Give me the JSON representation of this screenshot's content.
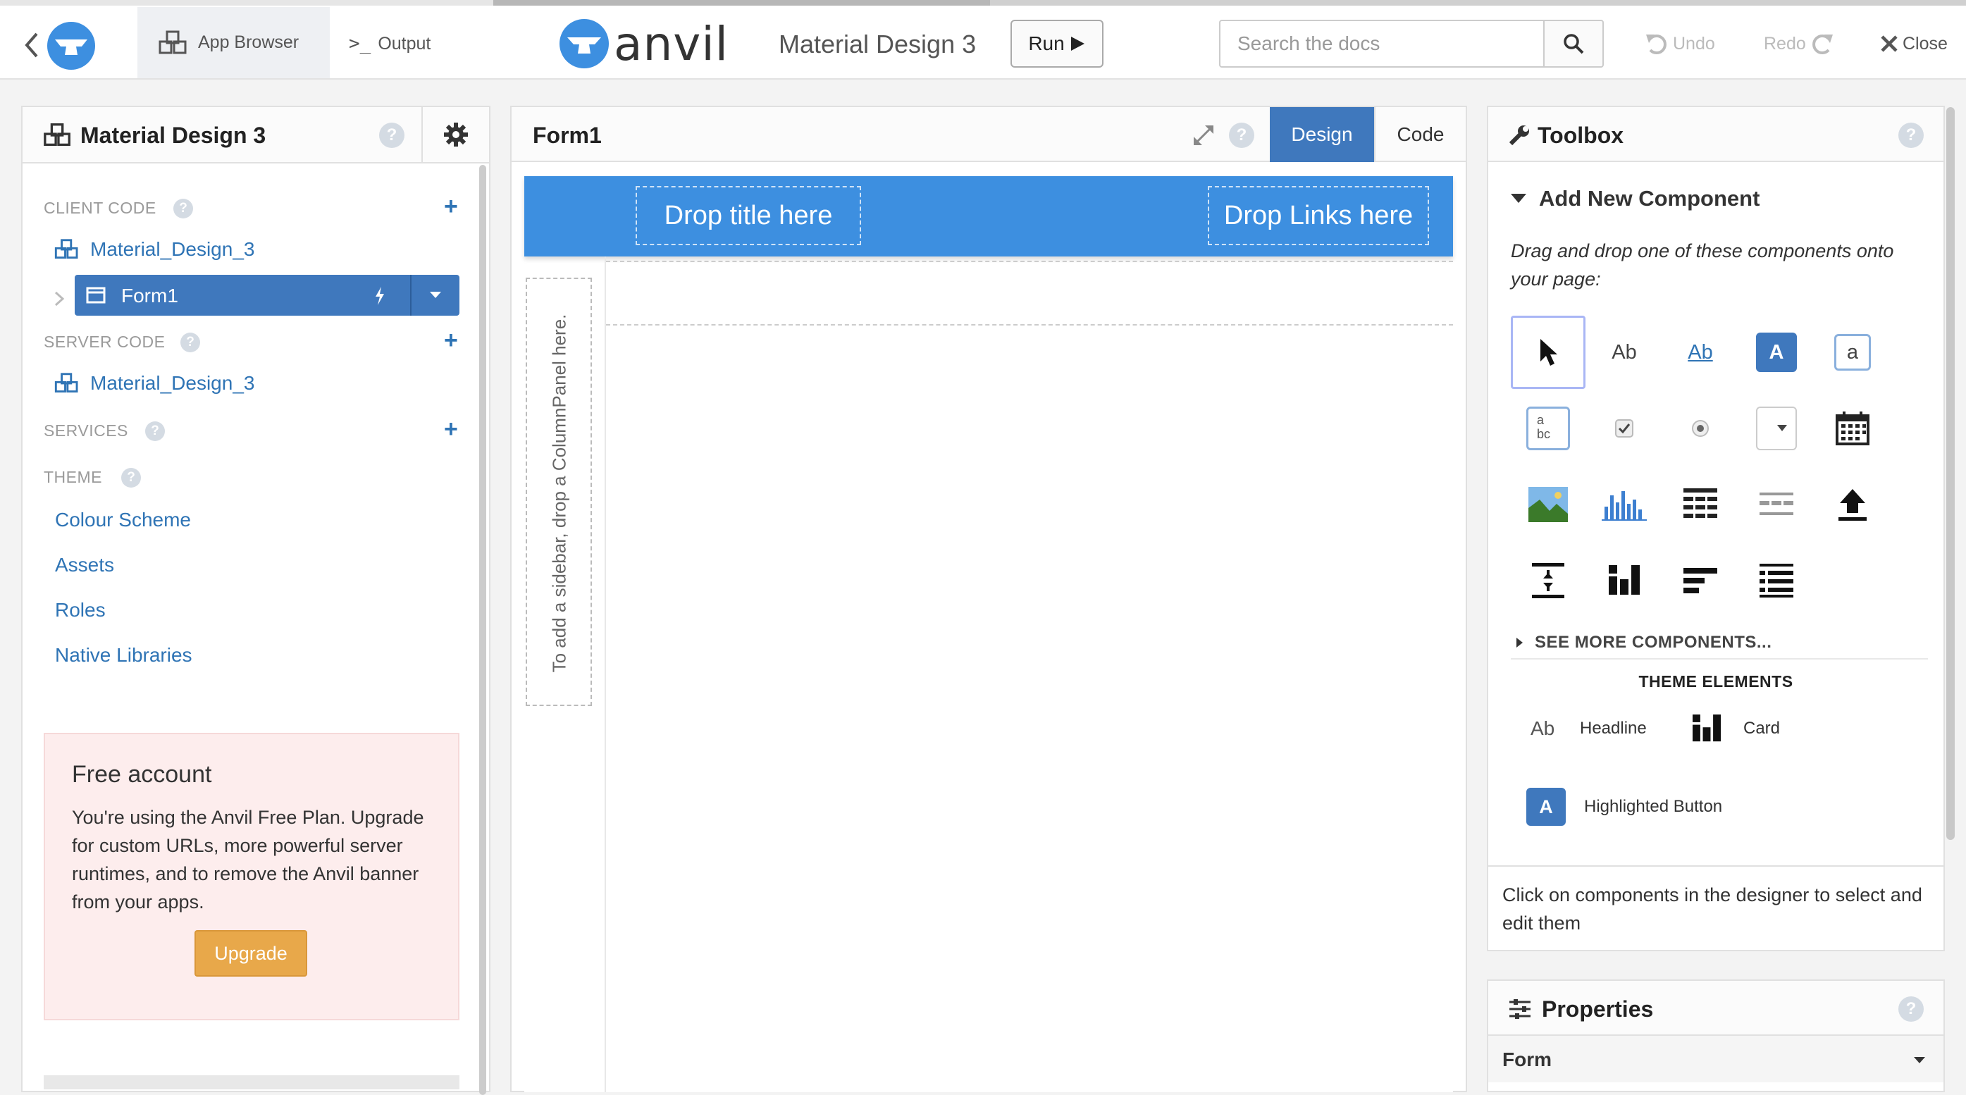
{
  "topbar": {
    "app_browser_label": "App Browser",
    "output_label": "Output",
    "logo_text": "anvil",
    "app_title": "Material Design 3",
    "run_label": "Run",
    "search_placeholder": "Search the docs",
    "undo_label": "Undo",
    "redo_label": "Redo",
    "close_label": "Close"
  },
  "sidebar": {
    "title": "Material Design 3",
    "client_code_header": "CLIENT CODE",
    "client_module": "Material_Design_3",
    "form_item": "Form1",
    "server_code_header": "SERVER CODE",
    "server_module": "Material_Design_3",
    "services_header": "SERVICES",
    "theme_header": "THEME",
    "theme_items": [
      "Colour Scheme",
      "Assets",
      "Roles",
      "Native Libraries"
    ],
    "free_account": {
      "title": "Free account",
      "body": "You're using the Anvil Free Plan. Upgrade for custom URLs, more powerful server runtimes, and to remove the Anvil banner from your apps.",
      "button": "Upgrade"
    }
  },
  "editor": {
    "form_title": "Form1",
    "design_tab": "Design",
    "code_tab": "Code",
    "drop_title": "Drop title here",
    "drop_links": "Drop Links here",
    "sidebar_hint": "To add a sidebar, drop a ColumnPanel here."
  },
  "toolbox": {
    "title": "Toolbox",
    "add_new_component": "Add New Component",
    "instructions": "Drag and drop one of these components onto your page:",
    "palette_text": {
      "label": "Ab",
      "link": "Ab",
      "button": "A",
      "textbox": "a",
      "textarea_top": "a",
      "textarea_bottom": "bc"
    },
    "see_more": "SEE MORE COMPONENTS...",
    "theme_elements_header": "THEME ELEMENTS",
    "theme_elements": {
      "headline_icon": "Ab",
      "headline": "Headline",
      "card": "Card",
      "highlighted_button_icon": "A",
      "highlighted_button": "Highlighted Button"
    },
    "footer_hint": "Click on components in the designer to select and edit them"
  },
  "properties": {
    "title": "Properties",
    "form_row": "Form"
  },
  "colors": {
    "accent": "#2f74b5",
    "anvil_blue": "#3d8fe0",
    "selected_blue": "#3f78bd",
    "upgrade_orange": "#e8a84a",
    "free_bg": "#fdeded"
  }
}
